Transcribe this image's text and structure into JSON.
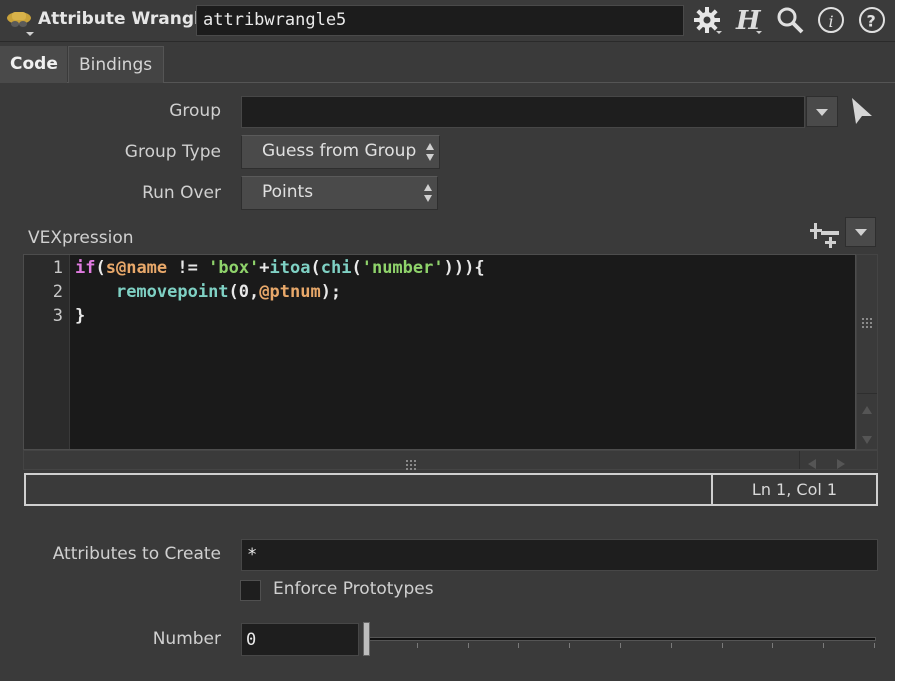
{
  "header": {
    "node_type": "Attribute Wrangle",
    "node_name": "attribwrangle5",
    "icons": [
      "wrangle-node-icon",
      "gear-icon",
      "houdini-help-icon",
      "search-icon",
      "info-icon",
      "help-icon"
    ]
  },
  "tabs": [
    {
      "label": "Code",
      "active": true
    },
    {
      "label": "Bindings",
      "active": false
    }
  ],
  "group": {
    "label": "Group",
    "value": ""
  },
  "group_type": {
    "label": "Group Type",
    "value": "Guess from Group"
  },
  "run_over": {
    "label": "Run Over",
    "value": "Points"
  },
  "vexpression": {
    "label": "VEXpression",
    "lines": [
      {
        "n": "1",
        "parts": [
          {
            "t": "if",
            "c": "kw"
          },
          {
            "t": "(",
            "c": ""
          },
          {
            "t": "s@name",
            "c": "var"
          },
          {
            "t": " != ",
            "c": ""
          },
          {
            "t": "'box'",
            "c": "str"
          },
          {
            "t": "+",
            "c": ""
          },
          {
            "t": "itoa",
            "c": "fn"
          },
          {
            "t": "(",
            "c": ""
          },
          {
            "t": "chi",
            "c": "fn"
          },
          {
            "t": "(",
            "c": ""
          },
          {
            "t": "'number'",
            "c": "str"
          },
          {
            "t": "))){",
            "c": ""
          }
        ]
      },
      {
        "n": "2",
        "parts": [
          {
            "t": "    ",
            "c": ""
          },
          {
            "t": "removepoint",
            "c": "fn"
          },
          {
            "t": "(0,",
            "c": ""
          },
          {
            "t": "@ptnum",
            "c": "var"
          },
          {
            "t": ");",
            "c": ""
          }
        ]
      },
      {
        "n": "3",
        "parts": [
          {
            "t": "}",
            "c": ""
          }
        ]
      }
    ],
    "status": "Ln 1, Col 1"
  },
  "attributes_to_create": {
    "label": "Attributes to Create",
    "value": "*"
  },
  "enforce_prototypes": {
    "label": "Enforce Prototypes",
    "checked": false
  },
  "number": {
    "label": "Number",
    "value": "0",
    "slider_fraction": 0
  }
}
